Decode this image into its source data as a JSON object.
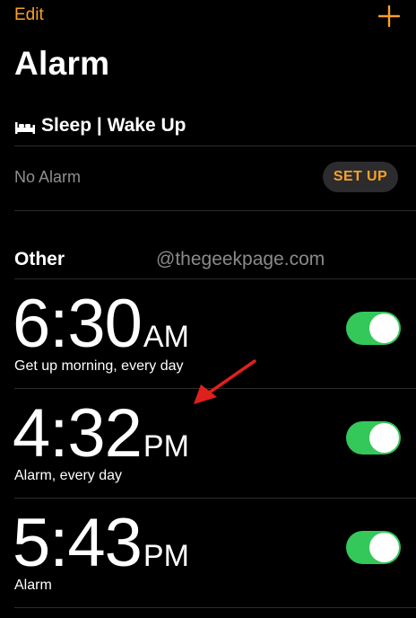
{
  "colors": {
    "accent": "#f7a128",
    "toggle_on": "#34c759",
    "arrow": "#e0201c"
  },
  "header": {
    "edit_label": "Edit",
    "add_icon": "plus-icon",
    "title": "Alarm"
  },
  "sleep": {
    "icon": "bed-icon",
    "title": "Sleep | Wake Up",
    "status": "No Alarm",
    "setup_label": "SET UP"
  },
  "other": {
    "title": "Other",
    "watermark": "@thegeekpage.com"
  },
  "alarms": [
    {
      "time": "6:30",
      "period": "AM",
      "label": "Get up morning, every day",
      "enabled": true
    },
    {
      "time": "4:32",
      "period": "PM",
      "label": "Alarm, every day",
      "enabled": true
    },
    {
      "time": "5:43",
      "period": "PM",
      "label": "Alarm",
      "enabled": true
    }
  ]
}
